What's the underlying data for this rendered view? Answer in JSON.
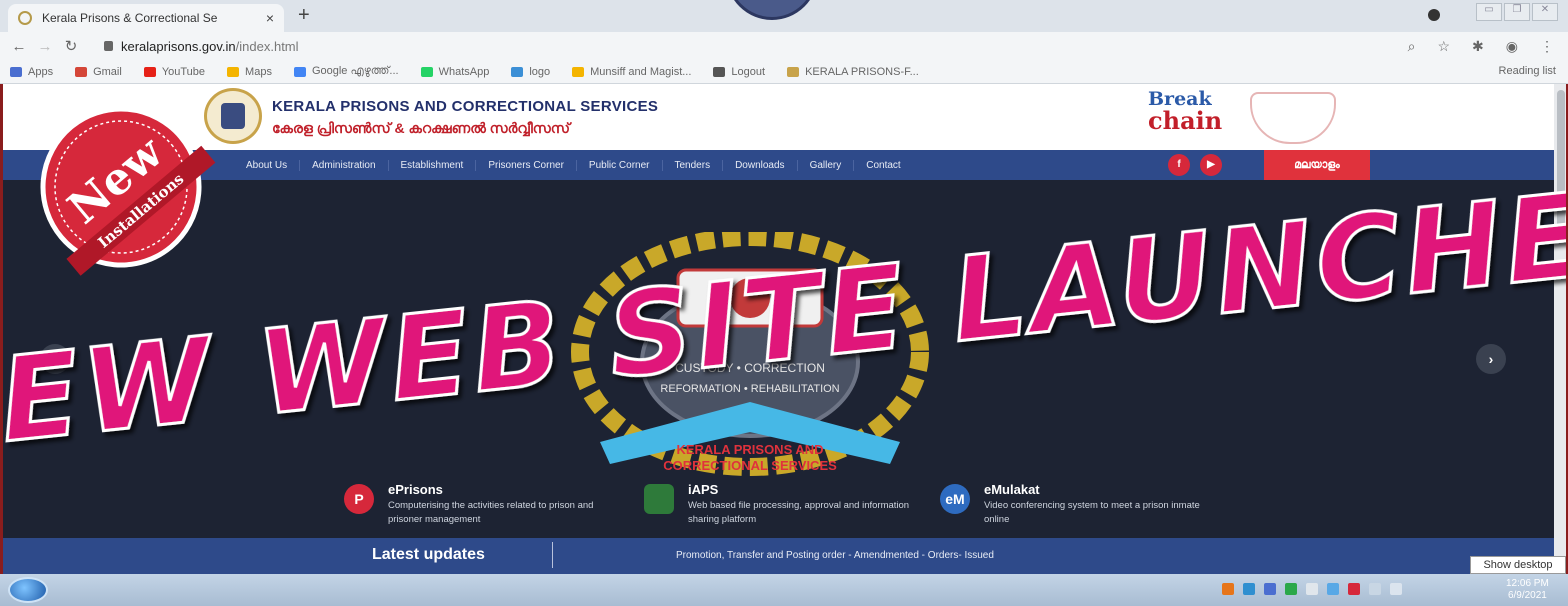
{
  "browser": {
    "tab_title": "Kerala Prisons & Correctional Se",
    "tab_close": "×",
    "new_tab": "+",
    "url_host": "keralaprisons.gov.in",
    "url_path": "/index.html",
    "bookmarks": [
      {
        "label": "Apps",
        "color": "#4a6ed0"
      },
      {
        "label": "Gmail",
        "color": "#d44638"
      },
      {
        "label": "YouTube",
        "color": "#e62117"
      },
      {
        "label": "Maps",
        "color": "#f4b400"
      },
      {
        "label": "Google എഴുത്ത്...",
        "color": "#4285f4"
      },
      {
        "label": "WhatsApp",
        "color": "#25d366"
      },
      {
        "label": "logo",
        "color": "#3b8fd6"
      },
      {
        "label": "Munsiff and Magist...",
        "color": "#f4b400"
      },
      {
        "label": "Logout",
        "color": "#555555"
      },
      {
        "label": "KERALA PRISONS-F...",
        "color": "#c8a34a"
      }
    ],
    "reading_list": "Reading list"
  },
  "site": {
    "title": "KERALA PRISONS AND CORRECTIONAL SERVICES",
    "subtitle": "കേരള പ്രിസൺസ് & കറക്ഷണൽ സർവ്വീസസ്",
    "break_the_chain_1": "Break",
    "break_the_chain_2": "chain",
    "nav": [
      "About Us",
      "Administration",
      "Establishment",
      "Prisoners Corner",
      "Public Corner",
      "Tenders",
      "Downloads",
      "Gallery",
      "Contact"
    ],
    "social": [
      "f",
      "▶"
    ],
    "language": "മലയാളം"
  },
  "hero": {
    "prev": "‹",
    "next": "›",
    "emblem_ribbon_1": "KERALA PRISONS AND",
    "emblem_ribbon_2": "CORRECTIONAL SERVICES",
    "emblem_ring_1": "CUSTODY • CORRECTION",
    "emblem_ring_2": "REFORMATION • REHABILITATION"
  },
  "services": [
    {
      "icon": "P",
      "title": "ePrisons",
      "desc": "Computerising the activities related to prison and prisoner management",
      "color": "#d6283b"
    },
    {
      "icon": "",
      "title": "iAPS",
      "desc": "Web based file processing, approval and information sharing platform",
      "color": "#2e7a3a"
    },
    {
      "icon": "eM",
      "title": "eMulakat",
      "desc": "Video conferencing system to meet a prison inmate online",
      "color": "#2e6bc0"
    }
  ],
  "updates": {
    "label": "Latest updates",
    "ticker": "Promotion, Transfer and Posting order - Amendmented - Orders- Issued"
  },
  "banner": {
    "headline": "NEW WEB SITE LAUNCHED",
    "badge_main": "New",
    "badge_sub": "Installations",
    "headline_color": "#e0157a"
  },
  "taskbar": {
    "time": "12:06 PM",
    "date": "6/9/2021",
    "show_desktop": "Show desktop"
  }
}
